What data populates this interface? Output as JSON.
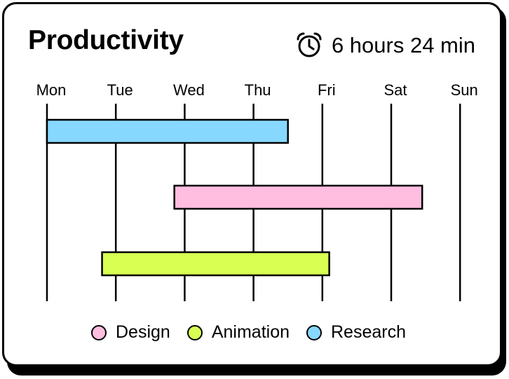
{
  "header": {
    "title": "Productivity",
    "duration": "6 hours 24 min",
    "duration_icon": "alarm-clock-icon"
  },
  "chart_data": {
    "type": "gantt",
    "categories": [
      "Mon",
      "Tue",
      "Wed",
      "Thu",
      "Fri",
      "Sat",
      "Sun"
    ],
    "grid": true,
    "legend_position": "bottom",
    "series": [
      {
        "name": "Research",
        "start": 0,
        "end": 3.5,
        "color": "#87d8ff"
      },
      {
        "name": "Design",
        "start": 1.85,
        "end": 5.45,
        "color": "#ffbde0"
      },
      {
        "name": "Animation",
        "start": 0.8,
        "end": 4.1,
        "color": "#d8ff52"
      }
    ]
  },
  "legend": {
    "items": [
      {
        "label": "Design",
        "color": "#ffbde0"
      },
      {
        "label": "Animation",
        "color": "#d8ff52"
      },
      {
        "label": "Research",
        "color": "#87d8ff"
      }
    ]
  }
}
